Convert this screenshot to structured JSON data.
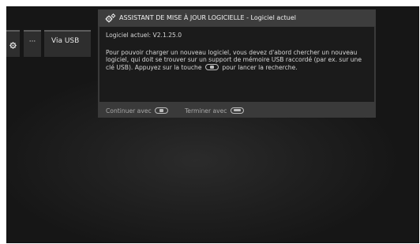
{
  "sidebar": {
    "dots_label": "···",
    "usb_label": "Via USB"
  },
  "dialog": {
    "title": "ASSISTANT DE MISE À JOUR LOGICIELLE - Logiciel actuel",
    "version_line": "Logiciel actuel: V2.1.25.0",
    "message_part1": "Pour pouvoir charger un nouveau logiciel, vous devez d'abord chercher un nouveau logiciel, qui doit se trouver sur un support de mémoire USB raccordé (par ex. sur une clé USB). Appuyez sur la touche",
    "message_part2": "pour lancer la recherche.",
    "footer_continue": "Continuer avec",
    "footer_finish": "Terminer avec"
  },
  "icons": {
    "settings": "gear-icon",
    "wizard": "gears-icon",
    "continue_key": "play-key-icon",
    "exit_key": "exit-key-icon"
  },
  "colors": {
    "background": "#1f1f1f",
    "dialog_frame": "#3a3a3a",
    "dialog_body": "#1b1b1b",
    "text": "#d6d6d6"
  }
}
